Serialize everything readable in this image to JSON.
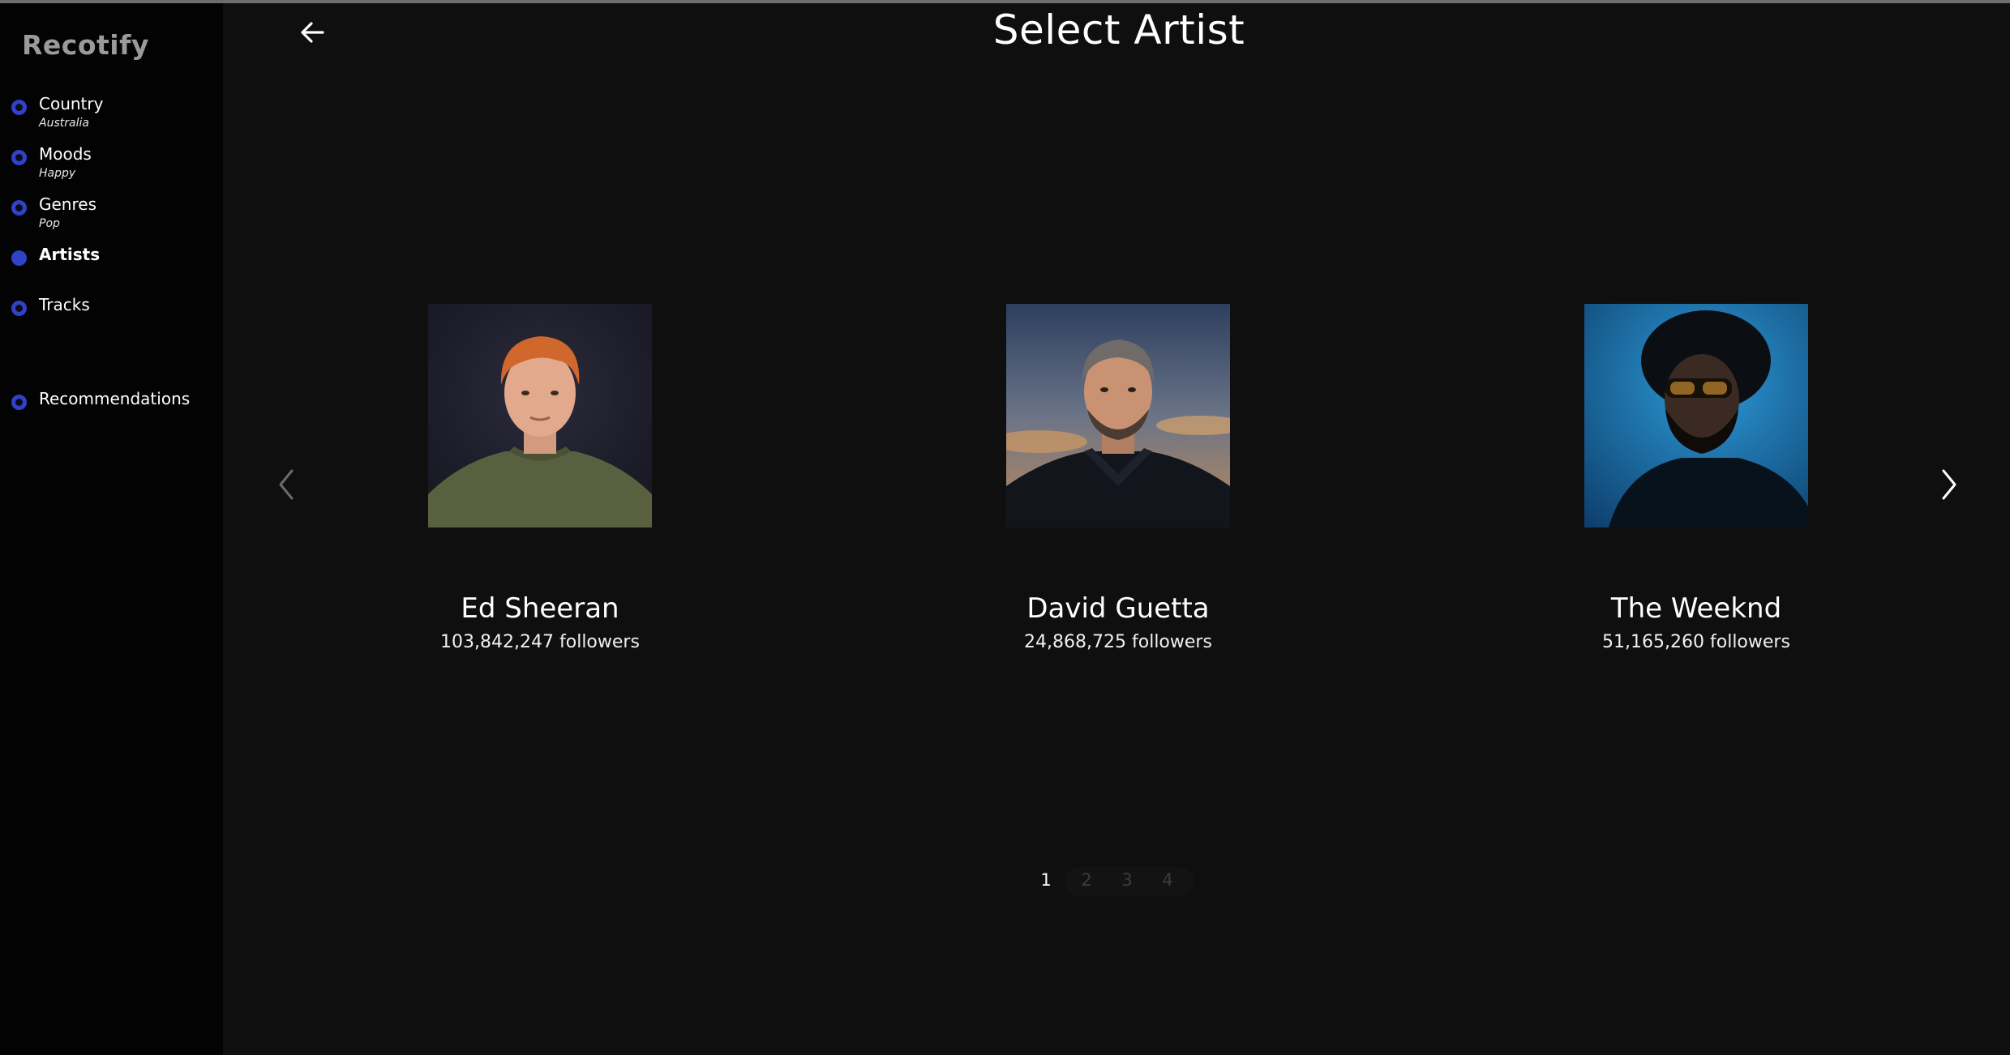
{
  "app": {
    "logo": "Recotify"
  },
  "sidebar": {
    "steps": [
      {
        "label": "Country",
        "value": "Australia",
        "active": false
      },
      {
        "label": "Moods",
        "value": "Happy",
        "active": false
      },
      {
        "label": "Genres",
        "value": "Pop",
        "active": false
      },
      {
        "label": "Artists",
        "value": "",
        "active": true
      },
      {
        "label": "Tracks",
        "value": "",
        "active": false
      },
      {
        "label": "Recommendations",
        "value": "",
        "active": false
      }
    ]
  },
  "header": {
    "title": "Select Artist",
    "back_icon": "arrow-left-icon"
  },
  "carousel": {
    "prev_icon": "chevron-left-icon",
    "next_icon": "chevron-right-icon",
    "artists": [
      {
        "name": "Ed Sheeran",
        "followers": "103,842,247 followers"
      },
      {
        "name": "David Guetta",
        "followers": "24,868,725 followers"
      },
      {
        "name": "The Weeknd",
        "followers": "51,165,260 followers"
      }
    ]
  },
  "pagination": {
    "pages": [
      "1",
      "2",
      "3",
      "4"
    ],
    "current": "1"
  },
  "colors": {
    "accent": "#2f42c8",
    "background": "#0f0f0f",
    "sidebar": "#030303"
  }
}
